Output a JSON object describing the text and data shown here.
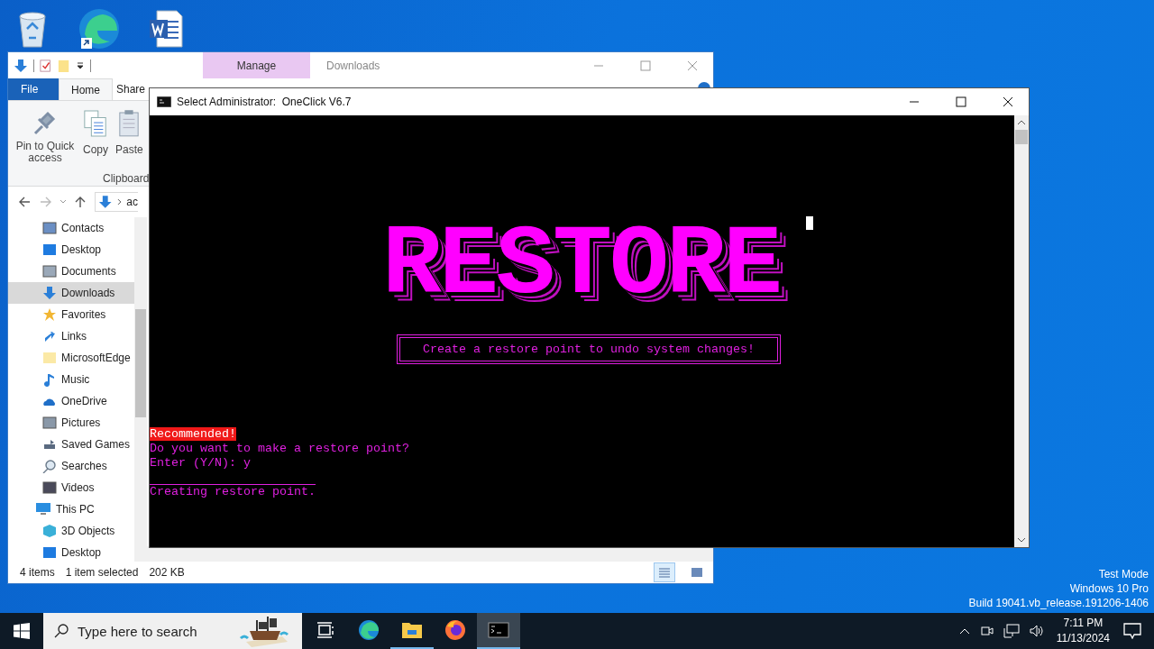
{
  "desktop_icons": [
    {
      "kind": "recycle_bin"
    },
    {
      "kind": "edge"
    },
    {
      "kind": "word"
    }
  ],
  "explorer": {
    "title": "Downloads",
    "context_tab": "Manage",
    "ribbon_tabs": [
      {
        "label": "File",
        "kind": "file",
        "selected": false
      },
      {
        "label": "Home",
        "kind": "tab",
        "selected": true
      },
      {
        "label": "Share",
        "kind": "tab",
        "selected": false
      }
    ],
    "ribbon_buttons": [
      {
        "label": "Pin to Quick access",
        "kind": "pin"
      },
      {
        "label": "Copy",
        "kind": "copy"
      },
      {
        "label": "Paste",
        "kind": "paste"
      }
    ],
    "group_label": "Clipboard",
    "address_crumb": "ac",
    "nav_pane": {
      "scrolled_items": [
        {
          "label": "Contacts",
          "kind": "contacts",
          "selected": false
        },
        {
          "label": "Desktop",
          "kind": "desktop",
          "selected": false
        },
        {
          "label": "Documents",
          "kind": "documents",
          "selected": false
        },
        {
          "label": "Downloads",
          "kind": "downloads",
          "selected": true
        },
        {
          "label": "Favorites",
          "kind": "favorites",
          "selected": false
        },
        {
          "label": "Links",
          "kind": "links",
          "selected": false
        },
        {
          "label": "MicrosoftEdge",
          "kind": "folder",
          "selected": false
        },
        {
          "label": "Music",
          "kind": "music",
          "selected": false
        },
        {
          "label": "OneDrive",
          "kind": "onedrive",
          "selected": false
        },
        {
          "label": "Pictures",
          "kind": "pictures",
          "selected": false
        },
        {
          "label": "Saved Games",
          "kind": "games",
          "selected": false
        },
        {
          "label": "Searches",
          "kind": "searches",
          "selected": false
        },
        {
          "label": "Videos",
          "kind": "videos",
          "selected": false
        }
      ],
      "items": [
        {
          "label": "This PC",
          "kind": "pc",
          "selected": false,
          "children": [
            {
              "label": "3D Objects",
              "kind": "objects3d",
              "selected": false
            },
            {
              "label": "Desktop",
              "kind": "desktop",
              "selected": false
            }
          ]
        }
      ]
    },
    "status_bar": {
      "count": "4 items",
      "selection": "1 item selected",
      "size": "202 KB"
    },
    "view_buttons": [
      {
        "kind": "details",
        "selected": true
      },
      {
        "kind": "large",
        "selected": false
      }
    ]
  },
  "console": {
    "title": "Select Administrator:  OneClick V6.7",
    "banner": "RESTORE",
    "boxed_text": "Create a restore point to undo system changes!",
    "lines": [
      {
        "kind": "alert",
        "text": "Recommended!"
      },
      {
        "kind": "normal",
        "text": "Do you want to make a restore point?"
      },
      {
        "kind": "normal",
        "text": "Enter (Y/N): y"
      },
      {
        "kind": "rule"
      },
      {
        "kind": "normal",
        "text": "Creating restore point."
      }
    ]
  },
  "desktop_notice": [
    "Test Mode",
    "Windows 10 Pro",
    "Build 19041.vb_release.191206-1406"
  ],
  "taskbar": {
    "search_placeholder": "Type here to search",
    "apps": [
      {
        "kind": "task_view",
        "running": false,
        "selected": false
      },
      {
        "kind": "edge",
        "running": false,
        "selected": false
      },
      {
        "kind": "explorer",
        "running": true,
        "selected": false
      },
      {
        "kind": "firefox",
        "running": false,
        "selected": false
      },
      {
        "kind": "console",
        "running": true,
        "selected": true
      }
    ],
    "time": "7:11 PM",
    "date": "11/13/2024"
  }
}
